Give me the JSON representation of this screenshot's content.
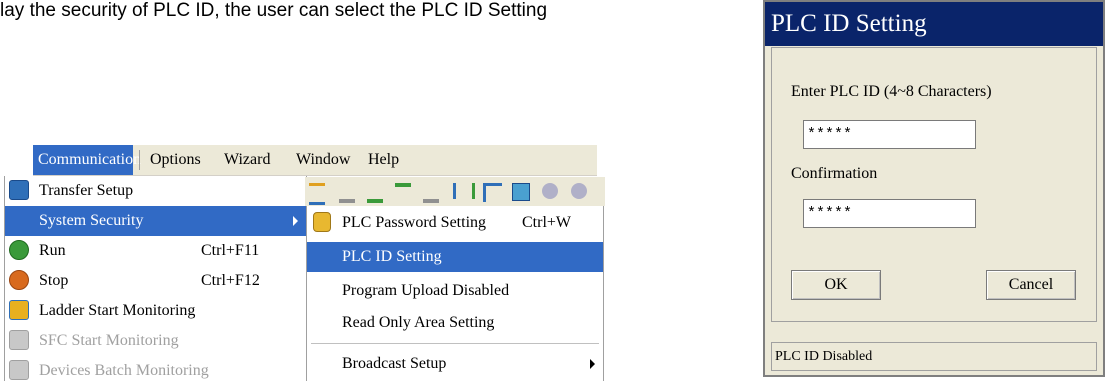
{
  "menubar": {
    "items": [
      {
        "label": "Communication",
        "active": true
      },
      {
        "label": "Options"
      },
      {
        "label": "Wizard"
      },
      {
        "label": "Window"
      },
      {
        "label": "Help"
      }
    ]
  },
  "comm_menu": {
    "items": [
      {
        "label": "Transfer Setup",
        "icon": "transfer-setup-icon"
      },
      {
        "label": "System Security",
        "submenu": true
      },
      {
        "label": "Run",
        "shortcut": "Ctrl+F11",
        "icon": "run-icon"
      },
      {
        "label": "Stop",
        "shortcut": "Ctrl+F12",
        "icon": "stop-icon"
      },
      {
        "label": "Ladder Start Monitoring",
        "icon": "ladder-monitor-icon"
      },
      {
        "label": "SFC Start Monitoring",
        "icon": "sfc-monitor-icon",
        "disabled": true
      },
      {
        "label": "Devices Batch Monitoring",
        "icon": "devices-batch-icon",
        "disabled": true
      }
    ]
  },
  "security_submenu": {
    "items": [
      {
        "label": "PLC Password Setting",
        "shortcut": "Ctrl+W",
        "icon": "lock-icon"
      },
      {
        "label": "PLC ID Setting"
      },
      {
        "label": "Program Upload Disabled"
      },
      {
        "label": "Read Only Area Setting"
      },
      {
        "label": "Broadcast Setup",
        "submenu": true
      }
    ]
  },
  "dialog": {
    "title": "PLC ID Setting",
    "enter_label": "Enter PLC ID (4~8 Characters)",
    "plc_id_value": "*****",
    "confirm_label": "Confirmation",
    "confirm_value": "*****",
    "ok_label": "OK",
    "cancel_label": "Cancel",
    "status": "PLC ID Disabled"
  },
  "top_text": {
    "text": "lay the security of PLC ID, the user can select the PLC ID Setting"
  },
  "colors": {
    "highlight": "#316ac5",
    "menu_bg": "#ece9d8",
    "title_bar": "#0a246a"
  }
}
